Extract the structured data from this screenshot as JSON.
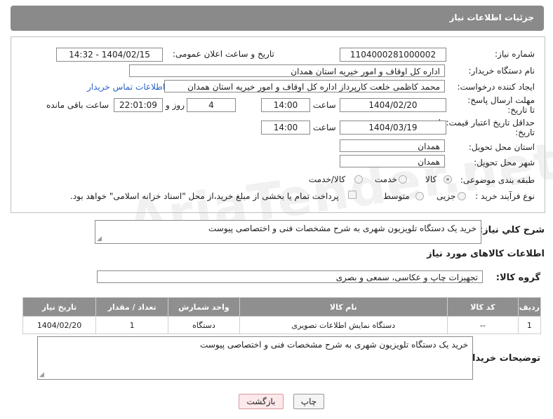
{
  "header": {
    "title": "جزئیات اطلاعات نیاز"
  },
  "form": {
    "need_number_label": "شماره نیاز:",
    "need_number": "1104000281000002",
    "announce_label": "تاریخ و ساعت اعلان عمومی:",
    "announce_value": "1404/02/15 - 14:32",
    "buyer_org_label": "نام دستگاه خریدار:",
    "buyer_org": "اداره کل اوقاف و امور خیریه استان همدان",
    "requester_label": "ایجاد کننده درخواست:",
    "requester": "محمد کاظمی خلعت کارپرداز اداره کل اوقاف و امور خیریه استان همدان",
    "contact_link": "اطلاعات تماس خریدار",
    "reply_deadline_label": "مهلت ارسال پاسخ: تا تاریخ:",
    "reply_date": "1404/02/20",
    "time_label": "ساعت",
    "reply_time": "14:00",
    "days_value": "4",
    "days_label": "روز و",
    "remaining_time": "22:01:09",
    "remaining_label": "ساعت باقی مانده",
    "price_validity_label": "حداقل تاریخ اعتبار قیمت: تا تاریخ:",
    "validity_date": "1404/03/19",
    "validity_time": "14:00",
    "province_label": "استان محل تحویل:",
    "province": "همدان",
    "city_label": "شهر محل تحویل:",
    "city": "همدان",
    "category_label": "طبقه بندی موضوعی:",
    "category_options": [
      "کالا",
      "خدمت",
      "کالا/خدمت"
    ],
    "process_label": "نوع فرآیند خرید :",
    "process_options": [
      "جزیی",
      "متوسط"
    ],
    "payment_note": "پرداخت تمام یا بخشی از مبلغ خرید،از محل \"اسناد خزانه اسلامی\" خواهد بود."
  },
  "description": {
    "label": "شرح کلي نياز:",
    "text": "خرید یک دستگاه تلویزیون شهری به شرح مشخصات فنی و اختصاصی پیوست"
  },
  "goods": {
    "section_title": "اطلاعات کالاهای مورد نیاز",
    "group_label": "گروه کالا:",
    "group_value": "تجهیزات چاپ و عکاسی، سمعی و بصری",
    "columns": [
      "ردیف",
      "کد کالا",
      "نام کالا",
      "واحد شمارش",
      "تعداد / مقدار",
      "تاریخ نیاز"
    ],
    "rows": [
      [
        "1",
        "--",
        "دستگاه نمایش اطلاعات تصویری",
        "دستگاه",
        "1",
        "1404/02/20"
      ]
    ]
  },
  "buyer_notes": {
    "label": "توضیحات خریدار:",
    "text": "خرید یک دستگاه تلویزیون شهری به شرح مشخصات فنی و اختصاصی پیوست"
  },
  "buttons": {
    "print": "چاپ",
    "back": "بازگشت"
  },
  "watermark": "AriaTender.net"
}
